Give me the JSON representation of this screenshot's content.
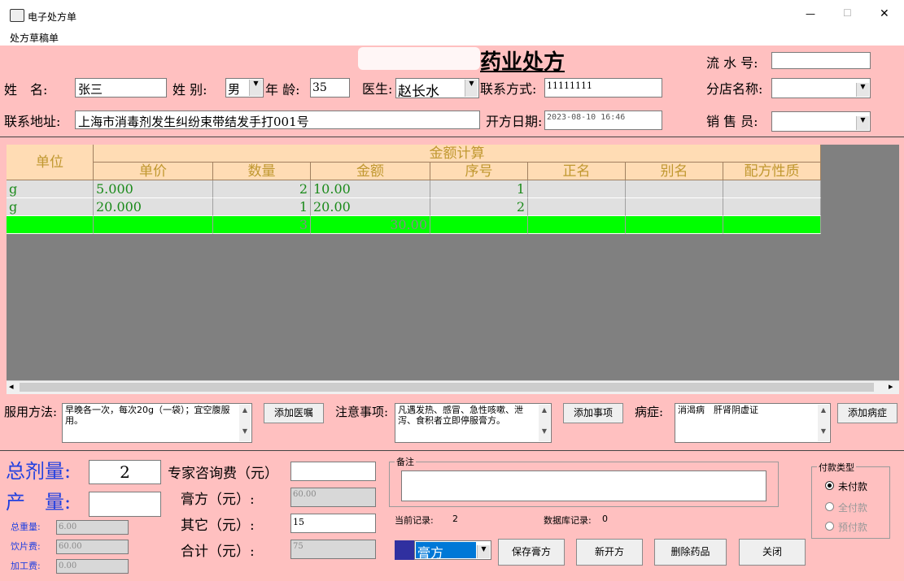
{
  "window": {
    "title": "电子处方单",
    "minimize": "—",
    "maximize": "☐",
    "close": "✕"
  },
  "menu": {
    "item": "处方草稿单"
  },
  "header": {
    "title_visible": "药业处方",
    "serial_label": "流 水 号:",
    "serial_value": "",
    "branch_label": "分店名称:",
    "branch_value": "",
    "sales_label": "销 售 员:",
    "sales_value": ""
  },
  "patient": {
    "name_label": "姓　名:",
    "name": "张三",
    "gender_label": "姓 别:",
    "gender": "男",
    "age_label": "年 龄:",
    "age": "35",
    "doctor_label": "医生:",
    "doctor": "赵长水",
    "contact_label": "联系方式:",
    "contact": "11111111",
    "address_label": "联系地址:",
    "address": "上海市消毒剂发生纠纷束带结发手打001号",
    "date_label": "开方日期:",
    "date": "2023-08-10 16:46"
  },
  "grid": {
    "group_header": "金额计算",
    "col_unit": "单位",
    "columns": [
      "单价",
      "数量",
      "金额",
      "序号",
      "正名",
      "别名",
      "配方性质"
    ],
    "rows": [
      {
        "unit": "g",
        "price": "5.000",
        "qty": "2",
        "amount": "10.00",
        "seq": "1",
        "name": "",
        "alias": "",
        "nature": ""
      },
      {
        "unit": "g",
        "price": "20.000",
        "qty": "1",
        "amount": "20.00",
        "seq": "2",
        "name": "",
        "alias": "",
        "nature": ""
      }
    ],
    "total": {
      "qty": "3",
      "amount": "30.00"
    },
    "scroll_left": "◂",
    "scroll_right": "▸"
  },
  "usage": {
    "label": "服用方法:",
    "text": "早晚各一次，每次20g（一袋）；宜空腹服用。",
    "button": "添加医嘱"
  },
  "notes": {
    "label": "注意事项:",
    "text": "凡遇发热、感冒、急性咳嗽、泄泻、食积者立即停服膏方。",
    "button": "添加事项"
  },
  "disease": {
    "label": "病症:",
    "text": "消渴病　肝肾阴虚证",
    "button": "添加病症"
  },
  "totals": {
    "dose_label": "总剂量:",
    "dose": "2",
    "yield_label": "产　量:",
    "yield": "",
    "weight_label": "总重量:",
    "weight": "6.00",
    "decoction_label": "饮片费:",
    "decoction": "60.00",
    "processing_label": "加工费:",
    "processing": "0.00"
  },
  "fees": {
    "consult_label": "专家咨询费（元）",
    "consult": "",
    "paste_label": "膏方（元）:",
    "paste": "60.00",
    "other_label": "其它（元）:",
    "other": "15",
    "total_label": "合计（元）:",
    "total": "75"
  },
  "remark": {
    "label": "备注",
    "text": ""
  },
  "records": {
    "current_label": "当前记录:",
    "current": "2",
    "db_label": "数据库记录:",
    "db": "0"
  },
  "type_select": {
    "value": "膏方"
  },
  "buttons": {
    "save": "保存膏方",
    "new": "新开方",
    "delete": "删除药品",
    "close": "关闭"
  },
  "payment": {
    "label": "付款类型",
    "unpaid": "未付款",
    "full": "全付款",
    "pre": "预付款"
  }
}
